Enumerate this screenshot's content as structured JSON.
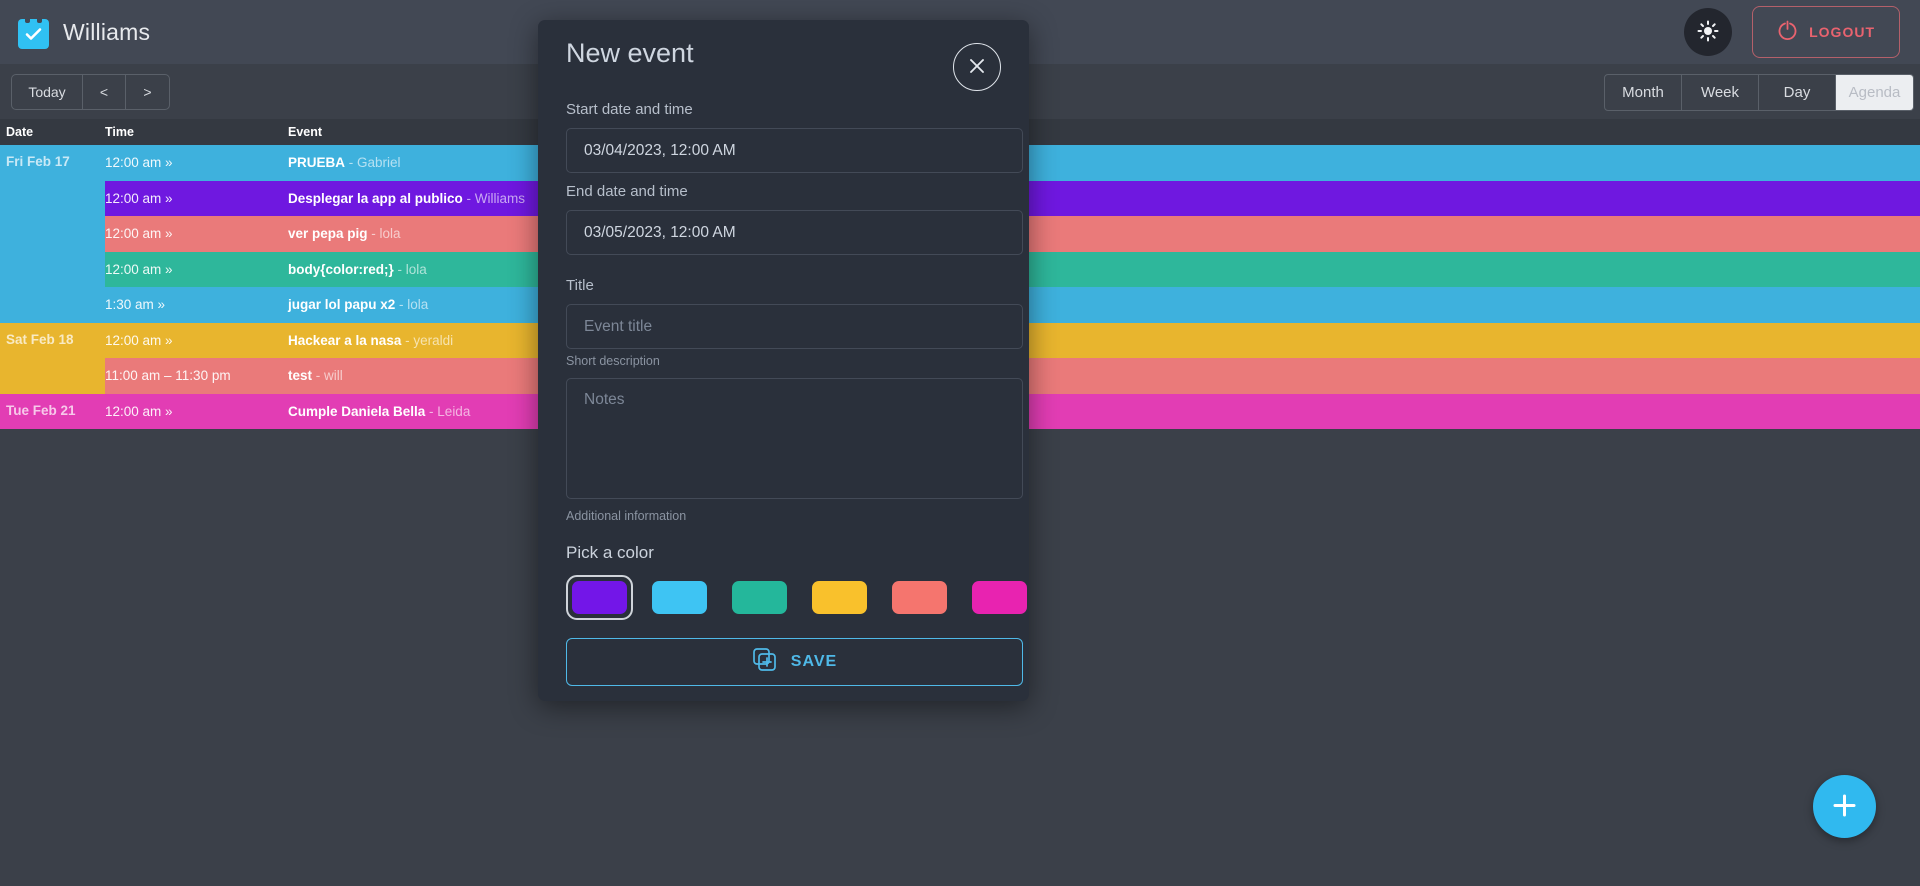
{
  "app": {
    "brand_name": "Williams",
    "brand_icon": "calendar-check-icon"
  },
  "navbar": {
    "theme_icon": "sun-icon",
    "logout_label": "LOGOUT",
    "logout_icon": "logout-icon"
  },
  "toolbar": {
    "today_label": "Today",
    "prev_label": "<",
    "next_label": ">",
    "views": [
      {
        "label": "Month",
        "active": false
      },
      {
        "label": "Week",
        "active": false
      },
      {
        "label": "Day",
        "active": false
      },
      {
        "label": "Agenda",
        "active": true
      }
    ]
  },
  "agenda": {
    "columns": {
      "date": "Date",
      "time": "Time",
      "event": "Event"
    },
    "days": [
      {
        "date": "Fri Feb 17",
        "bg": "#3eb1dd",
        "rows": [
          {
            "time": "12:00 am »",
            "title": "PRUEBA",
            "person": "Gabriel",
            "bg": "#3eb1dd"
          },
          {
            "time": "12:00 am »",
            "title": "Desplegar la app al publico",
            "person": "Williams",
            "bg": "#6f18e0"
          },
          {
            "time": "12:00 am »",
            "title": "ver pepa pig",
            "person": "lola",
            "bg": "#ea7a7a"
          },
          {
            "time": "12:00 am »",
            "title": "body{color:red;}",
            "person": "lola",
            "bg": "#2eb79b"
          },
          {
            "time": "1:30 am »",
            "title": "jugar lol papu x2",
            "person": "lola",
            "bg": "#3eb1dd"
          }
        ]
      },
      {
        "date": "Sat Feb 18",
        "bg": "#e8b52e",
        "rows": [
          {
            "time": "12:00 am »",
            "title": "Hackear a la nasa",
            "person": "yeraldi",
            "bg": "#e8b52e"
          },
          {
            "time": "11:00 am – 11:30 pm",
            "title": "test",
            "person": "will",
            "bg": "#ea7a7a"
          }
        ]
      },
      {
        "date": "Tue Feb 21",
        "bg": "#e23db4",
        "rows": [
          {
            "time": "12:00 am »",
            "title": "Cumple Daniela Bella",
            "person": "Leida",
            "bg": "#e23db4"
          }
        ]
      }
    ]
  },
  "fab": {
    "icon": "plus-icon"
  },
  "modal": {
    "title": "New event",
    "close_icon": "close-icon",
    "start_label": "Start date and time",
    "start_value": "03/04/2023, 12:00 AM",
    "end_label": "End date and time",
    "end_value": "03/05/2023, 12:00 AM",
    "title_label": "Title",
    "title_placeholder": "Event title",
    "title_value": "",
    "title_helper": "Short description",
    "notes_placeholder": "Notes",
    "notes_value": "",
    "notes_helper": "Additional information",
    "pick_color_label": "Pick a color",
    "colors": [
      {
        "hex": "#7316e8",
        "selected": true
      },
      {
        "hex": "#3ec4f3",
        "selected": false
      },
      {
        "hex": "#24b79b",
        "selected": false
      },
      {
        "hex": "#f9c12c",
        "selected": false
      },
      {
        "hex": "#f5756e",
        "selected": false
      },
      {
        "hex": "#e823b0",
        "selected": false
      }
    ],
    "save_label": "SAVE",
    "save_icon": "save-icon"
  }
}
